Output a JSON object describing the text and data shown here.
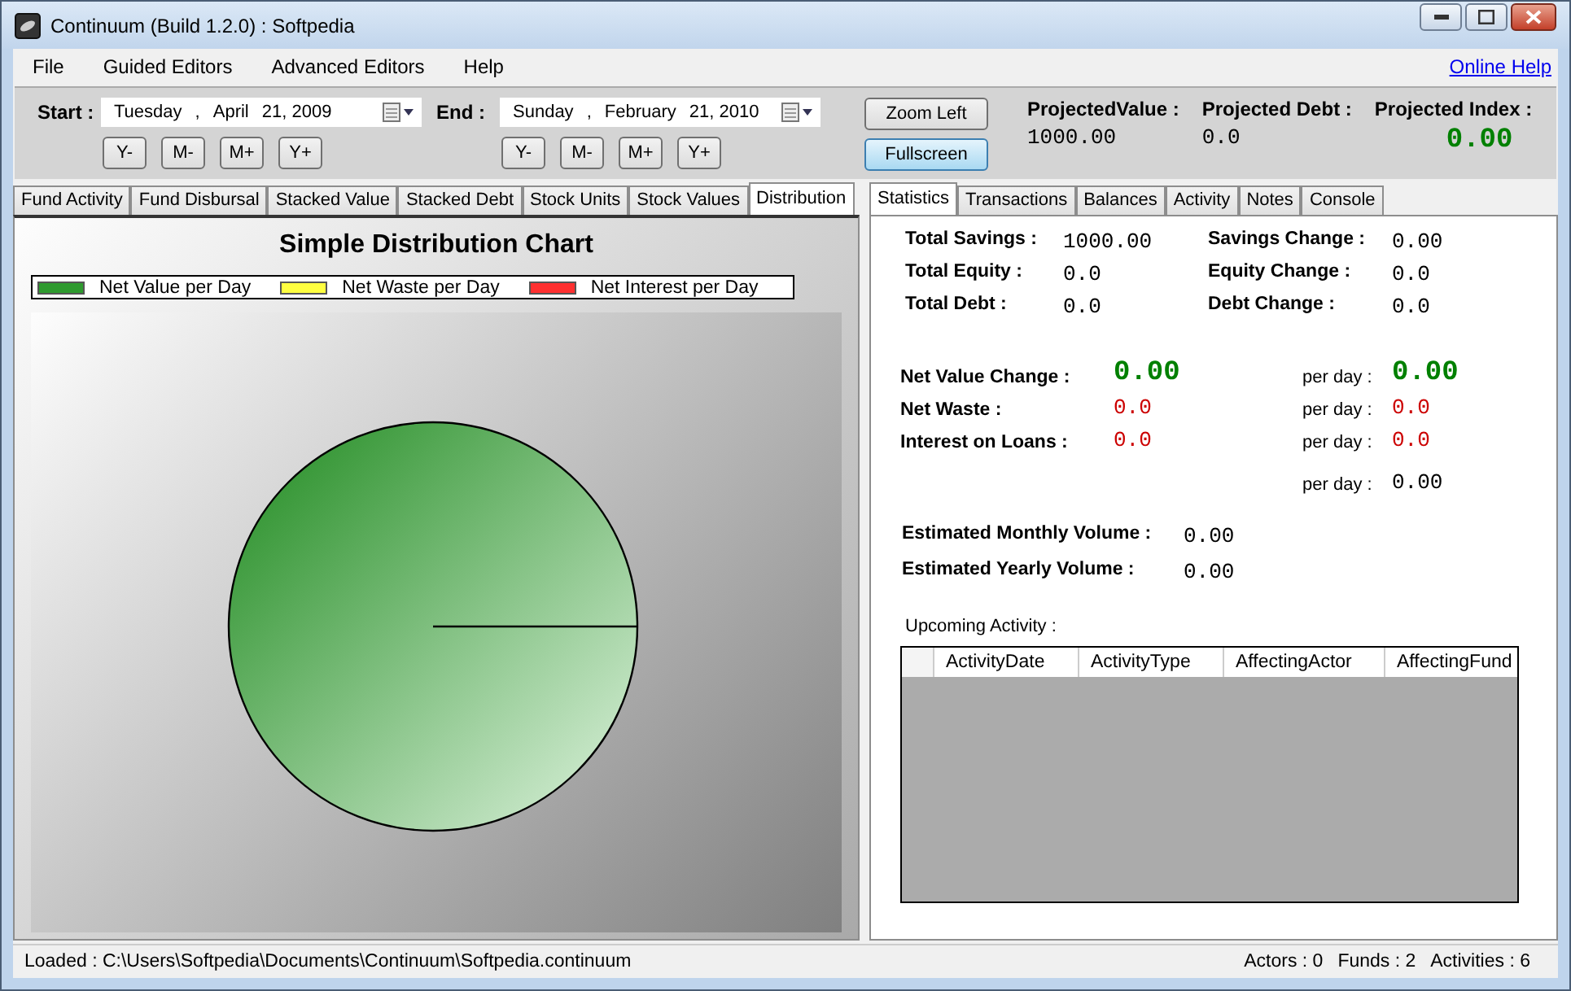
{
  "window": {
    "title": "Continuum (Build 1.2.0) : Softpedia"
  },
  "menu": [
    {
      "label": "File"
    },
    {
      "label": "Guided Editors"
    },
    {
      "label": "Advanced Editors"
    },
    {
      "label": "Help"
    }
  ],
  "online_help": "Online Help",
  "date_ranges": [
    {
      "label": "Start :",
      "parts": [
        "Tuesday",
        ",",
        "April",
        "21, 2009"
      ],
      "buttons": [
        "Y-",
        "M-",
        "M+",
        "Y+"
      ]
    },
    {
      "label": "End :",
      "parts": [
        "Sunday",
        ",",
        "February",
        "21, 2010"
      ],
      "buttons": [
        "Y-",
        "M-",
        "M+",
        "Y+"
      ]
    }
  ],
  "view_buttons": [
    {
      "label": "Zoom Left",
      "selected": false
    },
    {
      "label": "Fullscreen",
      "selected": true
    }
  ],
  "projections": [
    {
      "label": "ProjectedValue :",
      "value": "1000.00",
      "color": "#000000"
    },
    {
      "label": "Projected Debt :",
      "value": "0.0",
      "color": "#000000"
    },
    {
      "label": "Projected Index :",
      "value": "0.00",
      "color": "#008000"
    }
  ],
  "left_tabs": [
    {
      "label": "Fund Activity",
      "selected": false
    },
    {
      "label": "Fund Disbursal",
      "selected": false
    },
    {
      "label": "Stacked Value",
      "selected": false
    },
    {
      "label": "Stacked Debt",
      "selected": false
    },
    {
      "label": "Stock Units",
      "selected": false
    },
    {
      "label": "Stock Values",
      "selected": false
    },
    {
      "label": "Distribution",
      "selected": true
    }
  ],
  "chart": {
    "title": "Simple Distribution Chart",
    "legend": [
      {
        "label": "Net Value per Day",
        "color": "#2e9a2e"
      },
      {
        "label": "Net Waste per Day",
        "color": "#ffff40"
      },
      {
        "label": "Net Interest per Day",
        "color": "#ff3030"
      }
    ]
  },
  "right_tabs": [
    {
      "label": "Statistics",
      "selected": true
    },
    {
      "label": "Transactions",
      "selected": false
    },
    {
      "label": "Balances",
      "selected": false
    },
    {
      "label": "Activity",
      "selected": false
    },
    {
      "label": "Notes",
      "selected": false
    },
    {
      "label": "Console",
      "selected": false
    }
  ],
  "totals": [
    {
      "label": "Total Savings :",
      "value": "1000.00",
      "change_label": "Savings Change :",
      "change_value": "0.00"
    },
    {
      "label": "Total Equity :",
      "value": "0.0",
      "change_label": "Equity Change :",
      "change_value": "0.0"
    },
    {
      "label": "Total Debt :",
      "value": "0.0",
      "change_label": "Debt Change :",
      "change_value": "0.0"
    }
  ],
  "net": [
    {
      "label": "Net Value Change :",
      "value": "0.00",
      "color": "#008000",
      "per_day": {
        "label": "per day :",
        "value": "0.00",
        "color": "#008000"
      }
    },
    {
      "label": "Net Waste :",
      "value": "0.0",
      "color": "#cc0000",
      "per_day": {
        "label": "per day :",
        "value": "0.0",
        "color": "#cc0000"
      }
    },
    {
      "label": "Interest on Loans :",
      "value": "0.0",
      "color": "#cc0000",
      "per_day": {
        "label": "per day :",
        "value": "0.0",
        "color": "#cc0000"
      }
    },
    {
      "per_day": {
        "label": "per day :",
        "value": "0.00",
        "color": "#000000"
      }
    }
  ],
  "volumes": [
    {
      "label": "Estimated Monthly Volume :",
      "value": "0.00"
    },
    {
      "label": "Estimated Yearly Volume :",
      "value": "0.00"
    }
  ],
  "upcoming": {
    "label": "Upcoming Activity :",
    "columns": [
      "ActivityDate",
      "ActivityType",
      "AffectingActor",
      "AffectingFund"
    ]
  },
  "status_bar": {
    "path": "Loaded : C:\\Users\\Softpedia\\Documents\\Continuum\\Softpedia.continuum",
    "counts": [
      "Actors : 0",
      "Funds : 2",
      "Activities : 6"
    ]
  }
}
